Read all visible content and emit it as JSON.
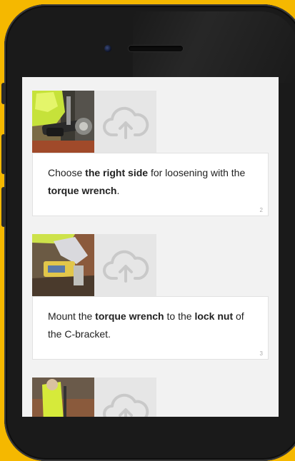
{
  "steps": [
    {
      "photo": "worker hand holding torque wrench on bolt",
      "upload_icon": "cloud-upload-icon",
      "parts": [
        "Choose ",
        "the right side",
        " for loosening with the ",
        "torque wrench",
        "."
      ],
      "number": "2"
    },
    {
      "photo": "torque wrench on lock nut",
      "upload_icon": "cloud-upload-icon",
      "parts": [
        "Mount the ",
        "torque wrench",
        " to the ",
        "lock nut",
        " of the C-bracket."
      ],
      "number": "3"
    },
    {
      "photo": "worker in hi-vis with wrench",
      "upload_icon": "cloud-upload-icon"
    }
  ],
  "colors": {
    "background": "#f5b800",
    "screen": "#f2f2f2",
    "card": "#ffffff",
    "upload": "#e6e6e6"
  }
}
